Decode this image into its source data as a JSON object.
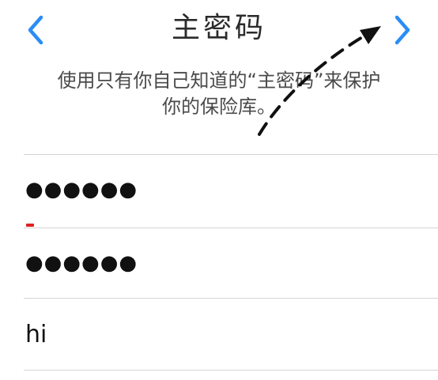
{
  "header": {
    "title": "主密码",
    "back_icon": "chevron-left-icon",
    "forward_icon": "chevron-right-icon"
  },
  "description": {
    "line1": "使用只有你自己知道的“主密码”来保护",
    "line2": "你的保险库。"
  },
  "form": {
    "password_value": "●●●●●●",
    "confirm_value": "●●●●●●",
    "hint_value": "hi"
  },
  "colors": {
    "accent": "#2a8df5",
    "error_mark": "#e02020",
    "divider": "#d4d4d4",
    "annotation_arrow": "#111111"
  },
  "annotation": {
    "icon": "dashed-arrow-icon"
  }
}
